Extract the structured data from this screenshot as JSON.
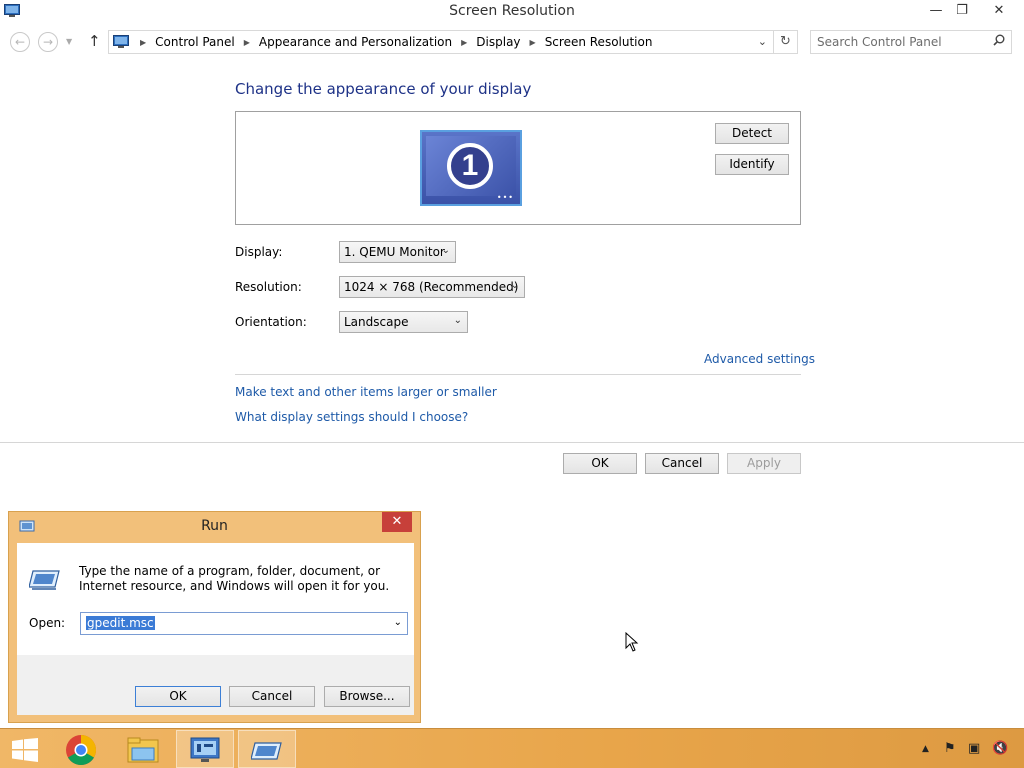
{
  "window": {
    "title": "Screen Resolution",
    "controls": {
      "minimize": "—",
      "restore": "❐",
      "close": "✕"
    }
  },
  "nav": {
    "back": "←",
    "forward": "→",
    "recent": "▼",
    "up": "↑",
    "breadcrumbs": [
      "Control Panel",
      "Appearance and Personalization",
      "Display",
      "Screen Resolution"
    ],
    "refresh": "↻",
    "search_placeholder": "Search Control Panel"
  },
  "main": {
    "heading": "Change the appearance of your display",
    "monitor_number": "1",
    "detect_label": "Detect",
    "identify_label": "Identify",
    "display_label": "Display:",
    "display_value": "1. QEMU Monitor",
    "resolution_label": "Resolution:",
    "resolution_value": "1024 × 768 (Recommended)",
    "orientation_label": "Orientation:",
    "orientation_value": "Landscape",
    "advanced_link": "Advanced settings",
    "link_text_size": "Make text and other items larger or smaller",
    "link_help": "What display settings should I choose?",
    "ok_label": "OK",
    "cancel_label": "Cancel",
    "apply_label": "Apply"
  },
  "run_dialog": {
    "title": "Run",
    "close": "✕",
    "message": "Type the name of a program, folder, document, or Internet resource, and Windows will open it for you.",
    "open_label": "Open:",
    "open_value": "gpedit.msc",
    "ok_label": "OK",
    "cancel_label": "Cancel",
    "browse_label": "Browse..."
  },
  "taskbar": {
    "items": [
      "start-icon",
      "chrome-icon",
      "file-explorer-icon",
      "control-panel-icon",
      "run-icon"
    ],
    "tray": {
      "show_hidden": "▲",
      "action_center": "⚑",
      "network": "▣",
      "volume": "🔇"
    }
  },
  "colors": {
    "heading": "#1e3287",
    "link": "#1e5aa8",
    "taskbar": "#e8a54a",
    "dialog_frame": "#f2c07a",
    "close_red": "#c7403a"
  }
}
